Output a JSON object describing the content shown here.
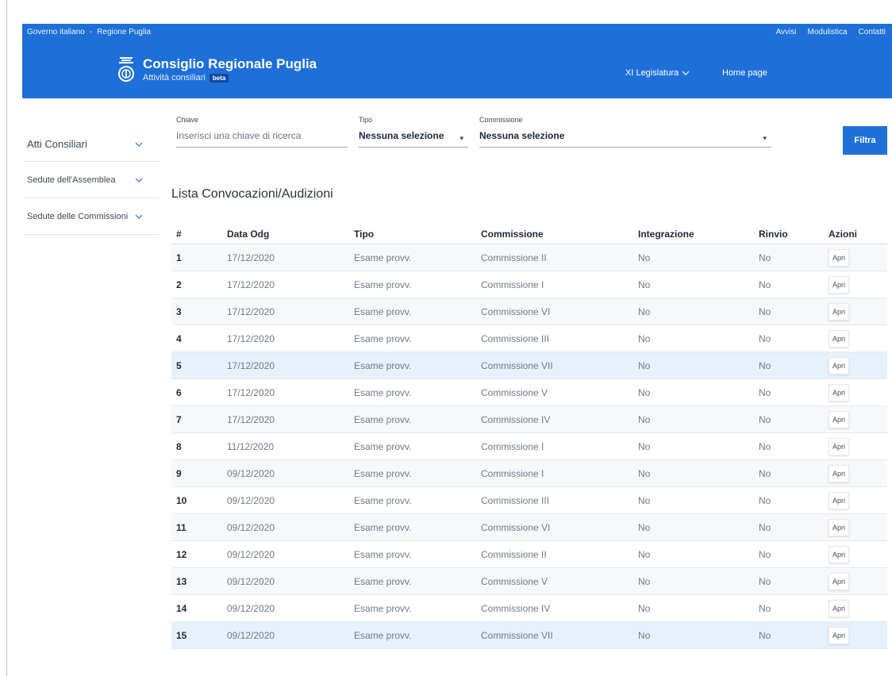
{
  "topbar": {
    "left": [
      "Governo italiano",
      "Regione Puglia"
    ],
    "separator": "-",
    "right": [
      "Avvisi",
      "Modulistica",
      "Contatti"
    ]
  },
  "brand": {
    "title": "Consiglio Regionale Puglia",
    "subtitle": "Attività consiliari",
    "badge": "beta"
  },
  "nav": {
    "legislatura": "XI Legislatura",
    "home": "Home page"
  },
  "sidebar": {
    "items": [
      {
        "label": "Atti Consiliari"
      },
      {
        "label": "Sedute dell'Assemblea"
      },
      {
        "label": "Sedute delle Commissioni"
      }
    ]
  },
  "filters": {
    "key_label": "Chiave",
    "key_placeholder": "Inserisci una chiave di ricerca",
    "tipo_label": "Tipo",
    "tipo_value": "Nessuna selezione",
    "comm_label": "Commissione",
    "comm_value": "Nessuna selezione",
    "button": "Filtra"
  },
  "list": {
    "title": "Lista Convocazioni/Audizioni",
    "columns": [
      "#",
      "Data Odg",
      "Tipo",
      "Commissione",
      "Integrazione",
      "Rinvio",
      "Azioni"
    ],
    "action_label": "Apri",
    "rows": [
      {
        "n": "1",
        "date": "17/12/2020",
        "tipo": "Esame provv.",
        "comm": "Commissione II",
        "integ": "No",
        "rinvio": "No"
      },
      {
        "n": "2",
        "date": "17/12/2020",
        "tipo": "Esame provv.",
        "comm": "Commissione I",
        "integ": "No",
        "rinvio": "No"
      },
      {
        "n": "3",
        "date": "17/12/2020",
        "tipo": "Esame provv.",
        "comm": "Commissione VI",
        "integ": "No",
        "rinvio": "No"
      },
      {
        "n": "4",
        "date": "17/12/2020",
        "tipo": "Esame provv.",
        "comm": "Commissione III",
        "integ": "No",
        "rinvio": "No"
      },
      {
        "n": "5",
        "date": "17/12/2020",
        "tipo": "Esame provv.",
        "comm": "Commissione VII",
        "integ": "No",
        "rinvio": "No",
        "highlight": true
      },
      {
        "n": "6",
        "date": "17/12/2020",
        "tipo": "Esame provv.",
        "comm": "Commissione V",
        "integ": "No",
        "rinvio": "No"
      },
      {
        "n": "7",
        "date": "17/12/2020",
        "tipo": "Esame provv.",
        "comm": "Commissione IV",
        "integ": "No",
        "rinvio": "No"
      },
      {
        "n": "8",
        "date": "11/12/2020",
        "tipo": "Esame provv.",
        "comm": "Commissione I",
        "integ": "No",
        "rinvio": "No"
      },
      {
        "n": "9",
        "date": "09/12/2020",
        "tipo": "Esame provv.",
        "comm": "Commissione I",
        "integ": "No",
        "rinvio": "No"
      },
      {
        "n": "10",
        "date": "09/12/2020",
        "tipo": "Esame provv.",
        "comm": "Commissione III",
        "integ": "No",
        "rinvio": "No"
      },
      {
        "n": "11",
        "date": "09/12/2020",
        "tipo": "Esame provv.",
        "comm": "Commissione VI",
        "integ": "No",
        "rinvio": "No"
      },
      {
        "n": "12",
        "date": "09/12/2020",
        "tipo": "Esame provv.",
        "comm": "Commissione II",
        "integ": "No",
        "rinvio": "No"
      },
      {
        "n": "13",
        "date": "09/12/2020",
        "tipo": "Esame provv.",
        "comm": "Commissione V",
        "integ": "No",
        "rinvio": "No"
      },
      {
        "n": "14",
        "date": "09/12/2020",
        "tipo": "Esame provv.",
        "comm": "Commissione IV",
        "integ": "No",
        "rinvio": "No"
      },
      {
        "n": "15",
        "date": "09/12/2020",
        "tipo": "Esame provv.",
        "comm": "Commissione VII",
        "integ": "No",
        "rinvio": "No",
        "highlight": true
      }
    ]
  },
  "colors": {
    "primary": "#1e70d8",
    "highlight_row": "#e6f1fb"
  }
}
